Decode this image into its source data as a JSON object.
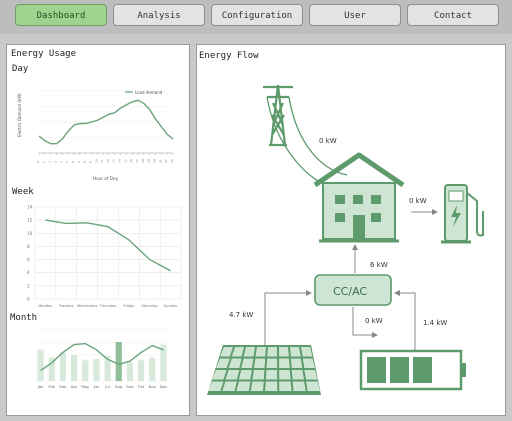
{
  "nav": {
    "tabs": [
      {
        "label": "Dashboard",
        "active": true
      },
      {
        "label": "Analysis",
        "active": false
      },
      {
        "label": "Configuration",
        "active": false
      },
      {
        "label": "User",
        "active": false
      },
      {
        "label": "Contact",
        "active": false
      }
    ]
  },
  "usage": {
    "title": "Energy Usage",
    "day": {
      "label": "Day",
      "legend": "Load demand",
      "xlabel": "Hour of Day",
      "ylabel": "Electric Demand (kW)"
    },
    "week": {
      "label": "Week",
      "yticks": [
        "14",
        "12",
        "10",
        "8",
        "6",
        "4",
        "2",
        "0"
      ],
      "days": [
        "Monday",
        "Tuesday",
        "Wednesday",
        "Thursday",
        "Friday",
        "Saturday",
        "Sunday"
      ]
    },
    "month": {
      "label": "Month",
      "months": [
        "Jan",
        "Feb",
        "Mar",
        "Apr",
        "May",
        "Jun",
        "Jul",
        "Aug",
        "Sep",
        "Oct",
        "Nov",
        "Dec"
      ]
    }
  },
  "flow": {
    "title": "Energy Flow",
    "grid_power": "0 kW",
    "charger_power": "0 kW",
    "converter_label": "CC/AC",
    "house_power": "6 kW",
    "solar_power": "4.7 kW",
    "battery_in": "0 kW",
    "battery_out": "1.4 kW"
  },
  "colors": {
    "accent": "#6aa37b",
    "accent_light": "#cfe5d3",
    "tab_active": "#9fd490"
  },
  "icons": [
    "pylon-icon",
    "house-icon",
    "ev-charger-icon",
    "solar-panel-icon",
    "battery-icon"
  ],
  "chart_data": [
    {
      "type": "line",
      "title": "Day",
      "xlabel": "Hour of Day",
      "ylabel": "Electric Demand (kW)",
      "x": [
        0,
        1,
        2,
        3,
        4,
        5,
        6,
        7,
        8,
        9,
        10,
        11,
        12,
        13,
        14,
        15,
        16,
        17,
        18,
        19,
        20,
        21,
        22,
        23
      ],
      "series": [
        {
          "name": "Load demand",
          "values": [
            1.1,
            0.8,
            0.6,
            0.6,
            0.9,
            1.4,
            1.8,
            1.9,
            1.9,
            2.0,
            2.1,
            2.3,
            2.5,
            2.6,
            2.9,
            3.1,
            3.3,
            3.4,
            3.2,
            2.8,
            2.2,
            1.7,
            1.2,
            0.9
          ]
        }
      ],
      "ylim": [
        0,
        4
      ]
    },
    {
      "type": "line",
      "title": "Week",
      "categories": [
        "Monday",
        "Tuesday",
        "Wednesday",
        "Thursday",
        "Friday",
        "Saturday",
        "Sunday"
      ],
      "values": [
        12.0,
        11.5,
        11.6,
        11.0,
        9.0,
        6.0,
        4.3
      ],
      "ylim": [
        0,
        14
      ]
    },
    {
      "type": "bar",
      "title": "Month",
      "categories": [
        "Jan",
        "Feb",
        "Mar",
        "Apr",
        "May",
        "Jun",
        "Jul",
        "Aug",
        "Sep",
        "Oct",
        "Nov",
        "Dec"
      ],
      "values": [
        60,
        45,
        55,
        50,
        40,
        42,
        48,
        75,
        35,
        40,
        45,
        70
      ],
      "line": [
        20,
        35,
        55,
        70,
        72,
        60,
        42,
        32,
        38,
        55,
        68,
        60
      ],
      "ylim": [
        0,
        100
      ]
    }
  ]
}
